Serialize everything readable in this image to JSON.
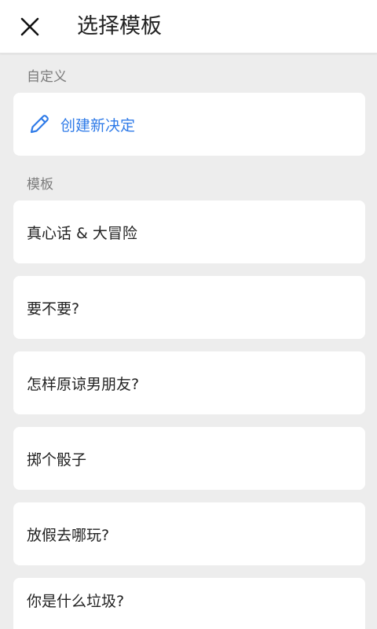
{
  "header": {
    "title": "选择模板"
  },
  "custom_section": {
    "label": "自定义",
    "create_label": "创建新决定"
  },
  "template_section": {
    "label": "模板",
    "items": [
      {
        "label": "真心话 & 大冒险"
      },
      {
        "label": "要不要?"
      },
      {
        "label": "怎样原谅男朋友?"
      },
      {
        "label": "掷个骰子"
      },
      {
        "label": "放假去哪玩?"
      },
      {
        "label": "你是什么垃圾?"
      }
    ]
  },
  "colors": {
    "accent": "#2f7be8",
    "background": "#ededed",
    "card": "#ffffff"
  },
  "icons": {
    "close": "close-icon",
    "create": "pencil-icon"
  }
}
